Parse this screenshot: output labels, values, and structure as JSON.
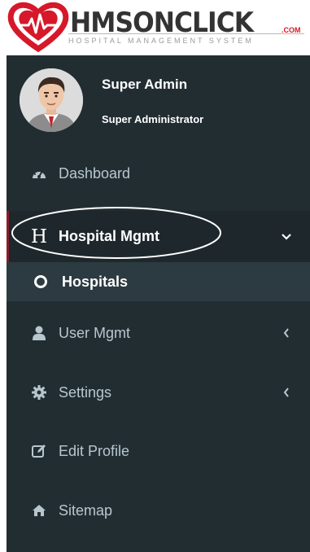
{
  "logo": {
    "brand": "HMSONCLICK",
    "domain_suffix": ".COM",
    "tagline": "HOSPITAL MANAGEMENT SYSTEM",
    "accent_color": "#d6182a"
  },
  "user": {
    "name": "Super Admin",
    "role": "Super Administrator"
  },
  "menu": [
    {
      "id": "dashboard",
      "label": "Dashboard",
      "icon": "dashboard-icon"
    },
    {
      "id": "hospital-mgmt",
      "label": "Hospital Mgmt",
      "icon": "h-letter-icon",
      "expanded": true,
      "arrow": "chevron-down-icon",
      "children": [
        {
          "id": "hospitals",
          "label": "Hospitals",
          "icon": "circle-outline-icon"
        }
      ]
    },
    {
      "id": "user-mgmt",
      "label": "User Mgmt",
      "icon": "user-icon",
      "arrow": "chevron-left-icon"
    },
    {
      "id": "settings",
      "label": "Settings",
      "icon": "gear-icon",
      "arrow": "chevron-left-icon"
    },
    {
      "id": "edit-profile",
      "label": "Edit Profile",
      "icon": "edit-icon"
    },
    {
      "id": "sitemap",
      "label": "Sitemap",
      "icon": "home-icon"
    }
  ],
  "colors": {
    "sidebar_bg": "#222d32",
    "active_bg": "#1e282c",
    "submenu_bg": "#2c3b41",
    "active_border": "#8a1c2b",
    "menu_text": "#b8c7ce"
  }
}
